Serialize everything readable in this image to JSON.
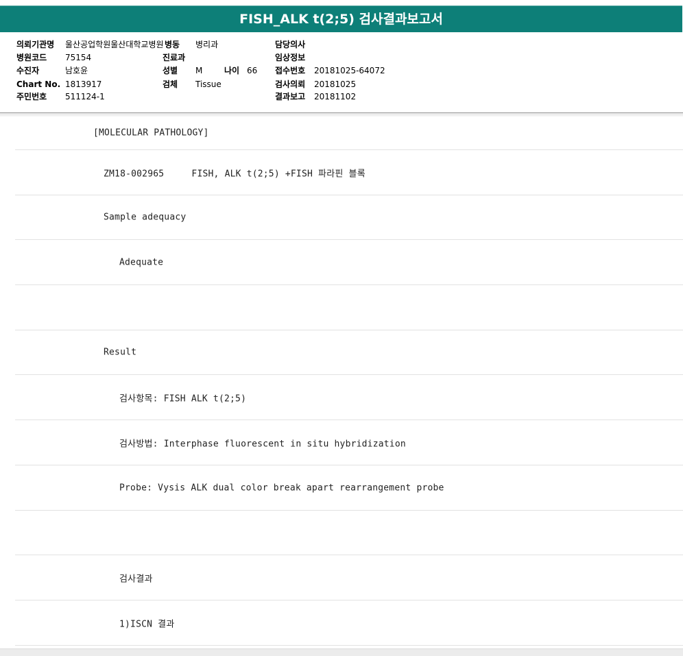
{
  "title": "FISH_ALK t(2;5) 검사결과보고서",
  "header": {
    "institution_label": "의뢰기관명",
    "institution_value": "울산공업학원울산대학교병원",
    "ward_label": "병동",
    "ward_value": "병리과",
    "doctor_label": "담당의사",
    "doctor_value": "",
    "hospital_code_label": "병원코드",
    "hospital_code_value": "75154",
    "department_label": "진료과",
    "department_value": "",
    "clinical_info_label": "임상정보",
    "clinical_info_value": "",
    "patient_label": "수진자",
    "patient_value": "남호윤",
    "sex_label": "성별",
    "sex_value": "M",
    "age_label": "나이",
    "age_value": "66",
    "accession_label": "접수번호",
    "accession_value": "20181025-64072",
    "chart_label": "Chart No.",
    "chart_value": "1813917",
    "specimen_label": "검체",
    "specimen_value": "Tissue",
    "request_label": "검사의뢰",
    "request_value": "20181025",
    "rrn_label": "주민번호",
    "rrn_value": "511124-1",
    "report_label": "결과보고",
    "report_value": "20181102"
  },
  "report_lines": [
    "[MOLECULAR PATHOLOGY]",
    "ZM18-002965     FISH, ALK t(2;5) +FISH 파라핀 블록",
    "Sample adequacy",
    "Adequate",
    "",
    "Result",
    "검사항목: FISH ALK t(2;5)",
    "검사방법: Interphase fluorescent in situ hybridization",
    "Probe: Vysis ALK dual color break apart rearrangement probe",
    "",
    "검사결과",
    "1)ISCN 결과"
  ]
}
